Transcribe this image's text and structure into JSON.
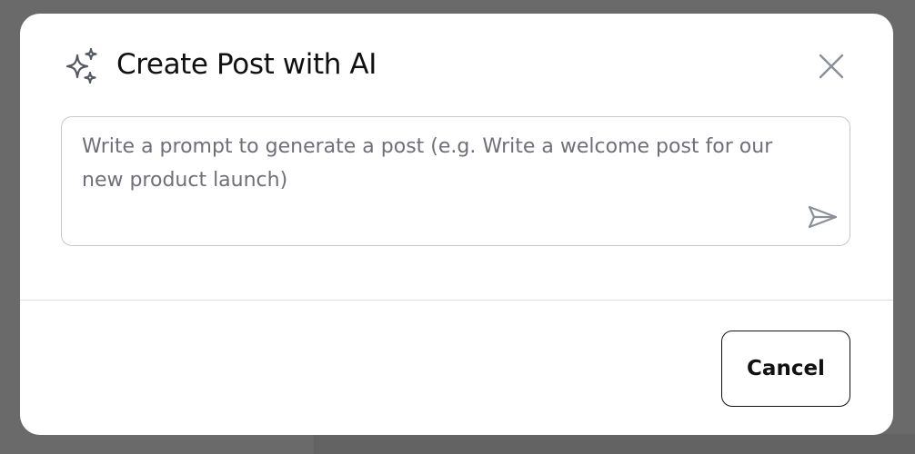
{
  "dialog": {
    "title": "Create Post with AI",
    "title_icon": "sparkles-icon",
    "close_icon": "close-icon"
  },
  "prompt": {
    "value": "",
    "placeholder": "Write a prompt to generate a post (e.g. Write a welcome post for our new product launch)",
    "send_icon": "send-icon"
  },
  "footer": {
    "cancel_label": "Cancel"
  },
  "colors": {
    "backdrop": "#6a6a6a",
    "modal_background": "#ffffff",
    "title_text": "#111111",
    "placeholder_text": "#6f6f78",
    "input_border": "#c8c8c8",
    "icon_gray": "#8a8f98",
    "divider": "#dedede"
  }
}
